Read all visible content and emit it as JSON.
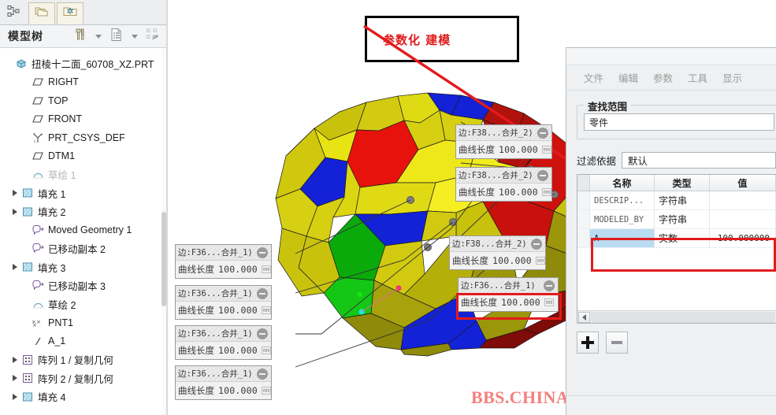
{
  "app": {
    "watermark": "BBS.CHINADE.NET"
  },
  "tree_panel": {
    "title": "模型树",
    "tabs": [
      {
        "name": "model-tree-tab",
        "icon": "node-tree-icon"
      },
      {
        "name": "folder-browser-tab",
        "icon": "folders-icon"
      },
      {
        "name": "favorites-tab",
        "icon": "folder-star-icon"
      }
    ],
    "header_buttons": [
      {
        "name": "settings-tools",
        "icon": "hammer-screwdriver-icon"
      },
      {
        "name": "settings-tools-caret",
        "icon": "chevron-down-icon"
      },
      {
        "name": "tree-filters",
        "icon": "list-document-icon"
      },
      {
        "name": "tree-filters-caret",
        "icon": "chevron-down-icon"
      },
      {
        "name": "tree-display",
        "icon": "tree-hide-icon"
      }
    ],
    "items": [
      {
        "label": "扭棱十二面_60708_XZ.PRT",
        "icon": "part-cube-icon",
        "indent": 0,
        "expander": false,
        "dim": false
      },
      {
        "label": "RIGHT",
        "icon": "datum-plane-icon",
        "indent": 1,
        "expander": false,
        "dim": false
      },
      {
        "label": "TOP",
        "icon": "datum-plane-icon",
        "indent": 1,
        "expander": false,
        "dim": false
      },
      {
        "label": "FRONT",
        "icon": "datum-plane-icon",
        "indent": 1,
        "expander": false,
        "dim": false
      },
      {
        "label": "PRT_CSYS_DEF",
        "icon": "coordinate-system-icon",
        "indent": 1,
        "expander": false,
        "dim": false
      },
      {
        "label": "DTM1",
        "icon": "datum-plane-icon",
        "indent": 1,
        "expander": false,
        "dim": false
      },
      {
        "label": "草绘 1",
        "icon": "sketch-icon",
        "indent": 1,
        "expander": false,
        "dim": true
      },
      {
        "label": "填充 1",
        "icon": "fill-surface-icon",
        "indent": 1,
        "expander": true,
        "dim": false
      },
      {
        "label": "填充 2",
        "icon": "fill-surface-icon",
        "indent": 1,
        "expander": true,
        "dim": false
      },
      {
        "label": "Moved Geometry 1",
        "icon": "moved-geometry-icon",
        "indent": 1,
        "expander": false,
        "dim": false
      },
      {
        "label": "已移动副本 2",
        "icon": "moved-geometry-icon",
        "indent": 1,
        "expander": false,
        "dim": false
      },
      {
        "label": "填充 3",
        "icon": "fill-surface-icon",
        "indent": 1,
        "expander": true,
        "dim": false
      },
      {
        "label": "已移动副本 3",
        "icon": "moved-geometry-icon",
        "indent": 1,
        "expander": false,
        "dim": false
      },
      {
        "label": "草绘 2",
        "icon": "sketch-icon",
        "indent": 1,
        "expander": false,
        "dim": false
      },
      {
        "label": "PNT1",
        "icon": "datum-point-icon",
        "indent": 1,
        "expander": false,
        "dim": false
      },
      {
        "label": "A_1",
        "icon": "datum-axis-icon",
        "indent": 1,
        "expander": false,
        "dim": false
      },
      {
        "label": "阵列 1 / 复制几何",
        "icon": "pattern-icon",
        "indent": 1,
        "expander": true,
        "dim": false
      },
      {
        "label": "阵列 2 / 复制几何",
        "icon": "pattern-icon",
        "indent": 1,
        "expander": true,
        "dim": false
      },
      {
        "label": "填充 4",
        "icon": "fill-surface-icon",
        "indent": 1,
        "expander": true,
        "dim": false
      }
    ]
  },
  "annotation": {
    "title_text": "参数化 建模",
    "title_color": "#e01b1b",
    "highlight_color": "#e21b1b"
  },
  "callouts": [
    {
      "id": "c1",
      "name": "边:F38...合并_2)",
      "dim_label": "曲线长度",
      "value": "100.000",
      "unit": "mm"
    },
    {
      "id": "c2",
      "name": "边:F38...合并_2)",
      "dim_label": "曲线长度",
      "value": "100.000",
      "unit": "mm"
    },
    {
      "id": "c3",
      "name": "边:F38...合并_2)",
      "dim_label": "曲线长度",
      "value": "100.000",
      "unit": "mm"
    },
    {
      "id": "c4",
      "name": "边:F36...合并_1)",
      "dim_label": "曲线长度",
      "value": "100.000",
      "unit": "mm"
    },
    {
      "id": "c5",
      "name": "边:F36...合并_1)",
      "dim_label": "曲线长度",
      "value": "100.000",
      "unit": "mm"
    },
    {
      "id": "c6",
      "name": "边:F36...合并_1)",
      "dim_label": "曲线长度",
      "value": "100.000",
      "unit": "mm"
    },
    {
      "id": "c7",
      "name": "边:F36...合并_1)",
      "dim_label": "曲线长度",
      "value": "100.000",
      "unit": "mm"
    },
    {
      "id": "c8",
      "name": "边:F36...合并_1)",
      "dim_label": "曲线长度",
      "value": "100.000",
      "unit": "mm"
    }
  ],
  "dialog": {
    "menu": [
      "文件",
      "编辑",
      "参数",
      "工具",
      "显示"
    ],
    "scope": {
      "legend": "查找范围",
      "value": "零件"
    },
    "filter": {
      "label": "过滤依据",
      "value": "默认"
    },
    "table": {
      "columns": [
        "名称",
        "类型",
        "值"
      ],
      "rows": [
        {
          "name": "DESCRIP...",
          "type": "字符串",
          "value": "",
          "selected": false
        },
        {
          "name": "MODELED_BY",
          "type": "字符串",
          "value": "",
          "selected": false
        },
        {
          "name": "A",
          "type": "实数",
          "value": "100.000000",
          "selected": true
        }
      ]
    },
    "buttons": [
      {
        "name": "add-parameter-button",
        "icon": "plus-icon"
      },
      {
        "name": "remove-parameter-button",
        "icon": "minus-icon"
      }
    ]
  }
}
